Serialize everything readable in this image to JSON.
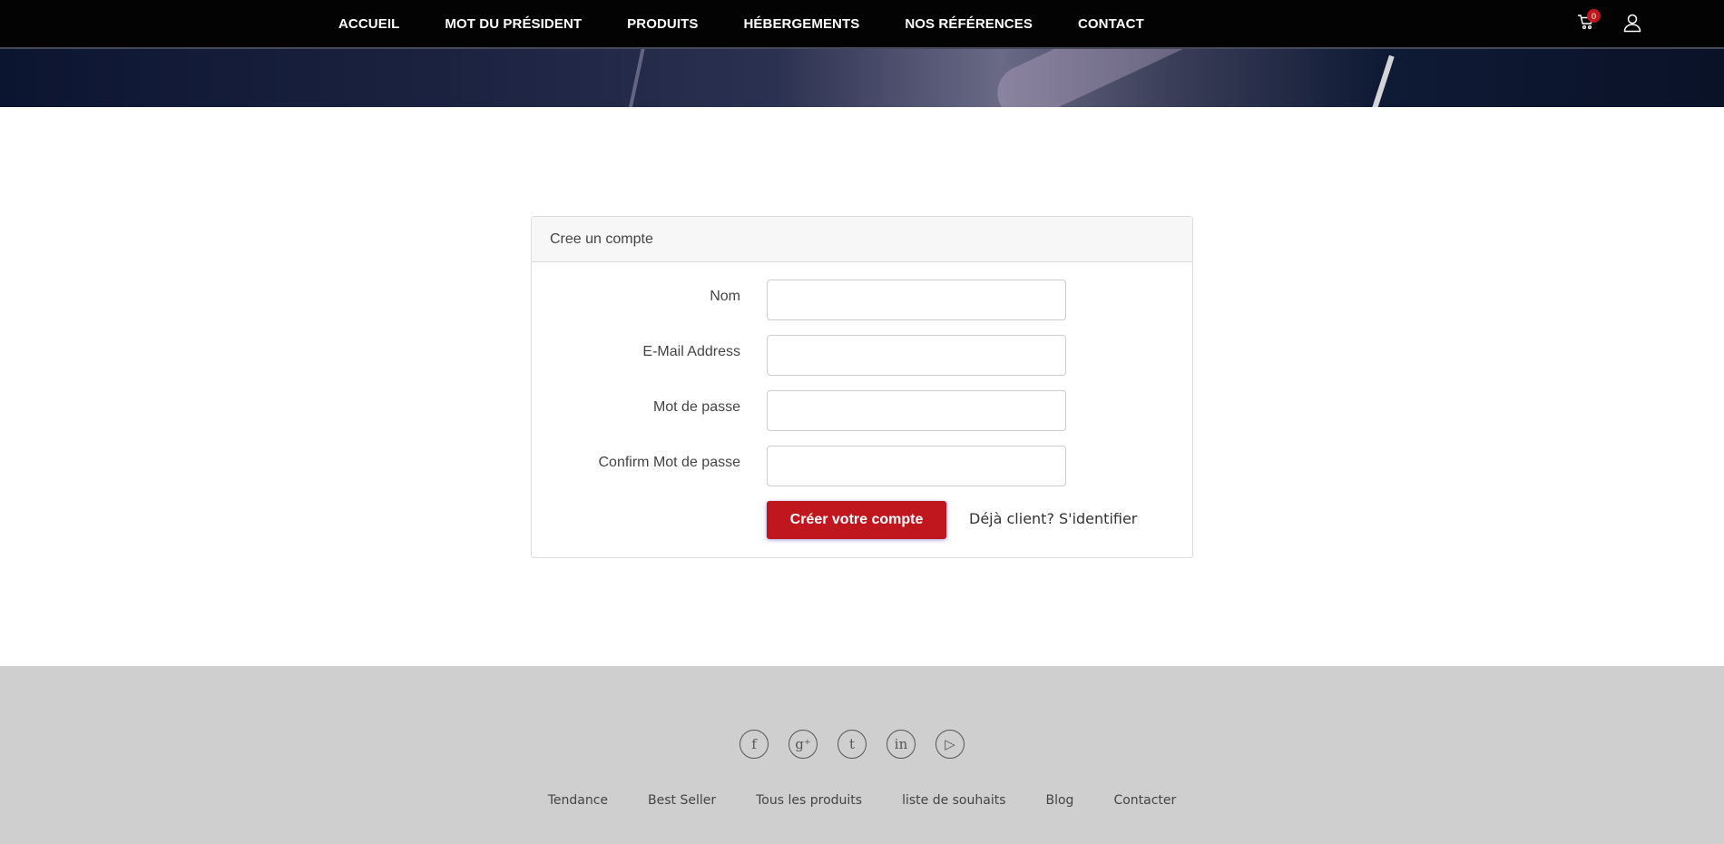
{
  "nav": {
    "items": [
      {
        "label": "ACCUEIL"
      },
      {
        "label": "MOT DU PRÉSIDENT"
      },
      {
        "label": "PRODUITS"
      },
      {
        "label": "HÉBERGEMENTS"
      },
      {
        "label": "NOS RÉFÉRENCES"
      },
      {
        "label": "CONTACT"
      }
    ],
    "cart_count": "0",
    "cart_icon": "cart-icon",
    "user_icon": "user-icon"
  },
  "form": {
    "title": "Cree un compte",
    "fields": [
      {
        "label": "Nom",
        "value": ""
      },
      {
        "label": "E-Mail Address",
        "value": ""
      },
      {
        "label": "Mot de passe",
        "value": ""
      },
      {
        "label": "Confirm Mot de passe",
        "value": ""
      }
    ],
    "submit_label": "Créer votre compte",
    "login_link": "Déjà client? S'identifier",
    "accent_color": "#c0171e"
  },
  "footer": {
    "socials": [
      {
        "icon": "facebook-icon",
        "glyph": "f"
      },
      {
        "icon": "google-plus-icon",
        "glyph": "g⁺"
      },
      {
        "icon": "tumblr-icon",
        "glyph": "t"
      },
      {
        "icon": "linkedin-icon",
        "glyph": "in"
      },
      {
        "icon": "youtube-icon",
        "glyph": "▷"
      }
    ],
    "links": [
      {
        "label": "Tendance"
      },
      {
        "label": "Best Seller"
      },
      {
        "label": "Tous les produits"
      },
      {
        "label": "liste de souhaits"
      },
      {
        "label": "Blog"
      },
      {
        "label": "Contacter"
      }
    ]
  }
}
